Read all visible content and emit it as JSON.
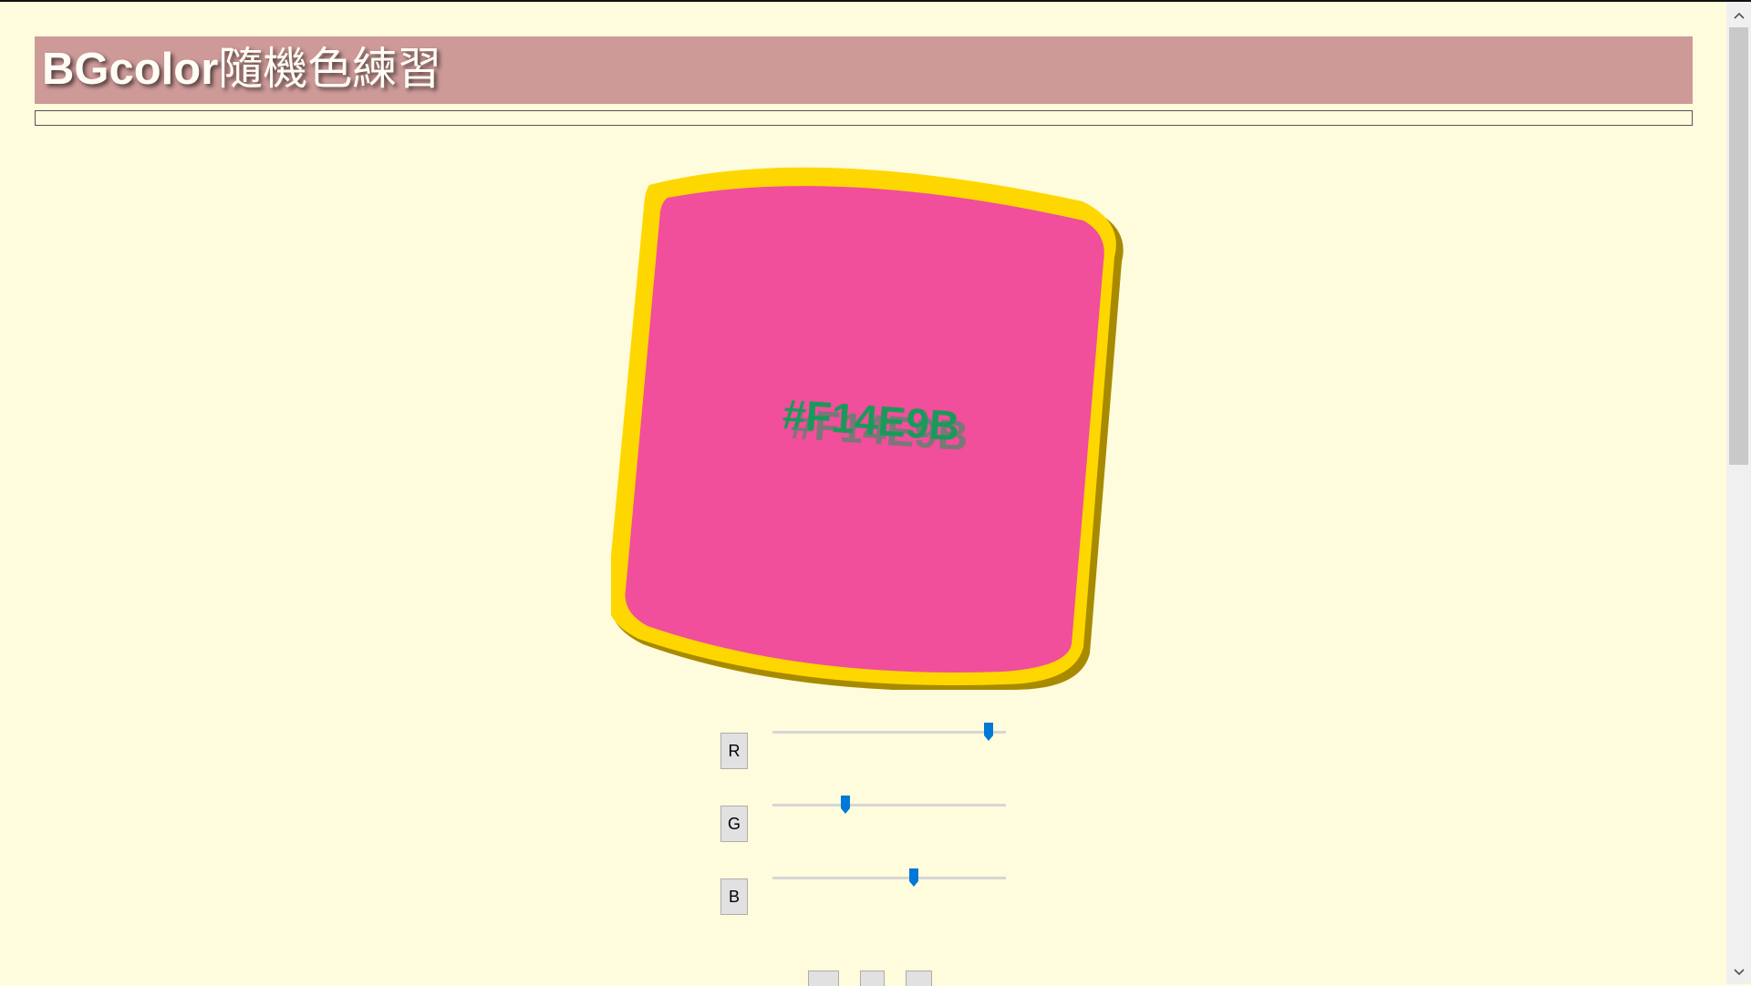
{
  "header": {
    "title_latin": "BGcolor",
    "title_cjk": "隨機色練習"
  },
  "swatch": {
    "hex_text": "#F14E9B",
    "fill_color": "#f14e9b",
    "border_color": "#ffd700",
    "border_shadow_color": "#a88a00",
    "text_color": "#1a9a5a"
  },
  "sliders": [
    {
      "label": "R",
      "value": 241,
      "max": 255
    },
    {
      "label": "G",
      "value": 78,
      "max": 255
    },
    {
      "label": "B",
      "value": 155,
      "max": 255
    }
  ],
  "colors": {
    "page_background": "#fefcdc",
    "header_background": "#cd9a98",
    "slider_thumb": "#0078d7"
  },
  "icons": {
    "scroll_up": "chevron-up-icon",
    "scroll_down": "chevron-down-icon"
  }
}
